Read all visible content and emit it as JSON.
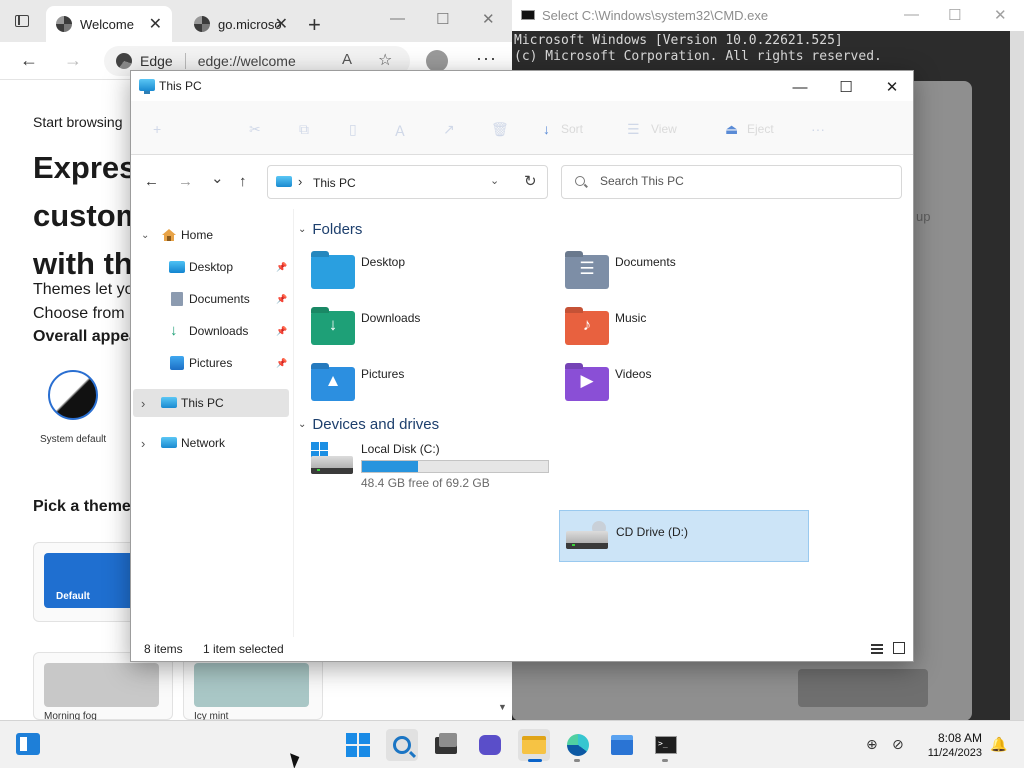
{
  "edge": {
    "tabs": [
      {
        "title": "Welcome",
        "close": "✕"
      },
      {
        "title": "go.microso",
        "close": "✕"
      }
    ],
    "new_tab": "+",
    "window_controls": {
      "minimize": "—",
      "maximize": "☐",
      "close": "✕"
    },
    "address": {
      "site_label": "Edge",
      "url": "edge://welcome"
    },
    "content": {
      "start_browsing": "Start browsing",
      "heading_lines": [
        "Express",
        "custom",
        "with th"
      ],
      "body_lines": [
        "Themes let yo",
        "Choose from"
      ],
      "overall_appearance": "Overall appea",
      "system_default": "System default",
      "pick_theme": "Pick a theme",
      "themes": [
        {
          "name": "Default",
          "color": "#1f6fd0"
        },
        {
          "name": "Morning fog",
          "color": "#c8c8c8"
        },
        {
          "name": "Icy mint",
          "color": "#a9c7c6"
        }
      ]
    }
  },
  "cmd": {
    "title": "Select C:\\Windows\\system32\\CMD.exe",
    "lines": [
      "Microsoft Windows [Version 10.0.22621.525]",
      "(c) Microsoft Corporation. All rights reserved."
    ],
    "overlay_text": "up",
    "window_controls": {
      "minimize": "—",
      "maximize": "☐",
      "close": "✕"
    }
  },
  "explorer": {
    "title": "This PC",
    "window_controls": {
      "minimize": "—",
      "maximize": "☐",
      "close": "✕"
    },
    "ribbon": {
      "icons": [
        "+",
        "✂",
        "⧉",
        "▯",
        "Ａ",
        "↗",
        "🗑",
        "↓",
        "☰",
        "⏏",
        "···"
      ],
      "labels": [
        "Sort",
        "View",
        "Eject"
      ]
    },
    "nav": {
      "back": "←",
      "forward": "→",
      "recent": "⌄",
      "up": "↑",
      "address_sep": "›",
      "address_location": "This PC",
      "address_dropdown": "⌄",
      "refresh": "↻",
      "search_placeholder": "Search This PC"
    },
    "sidebar": {
      "home": "Home",
      "quick_access": [
        {
          "label": "Desktop",
          "pin": "📌"
        },
        {
          "label": "Documents",
          "pin": "📌"
        },
        {
          "label": "Downloads",
          "pin": "📌"
        },
        {
          "label": "Pictures",
          "pin": "📌"
        }
      ],
      "this_pc": "This PC",
      "network": "Network",
      "chevron_open": "⌄",
      "chevron_closed": "›"
    },
    "folders_header": "Folders",
    "folders": [
      {
        "name": "Desktop",
        "glyph": "",
        "color": "#2a9fe0"
      },
      {
        "name": "Documents",
        "glyph": "☰",
        "color": "#7d8ea6"
      },
      {
        "name": "Downloads",
        "glyph": "↓",
        "color": "#1ea077"
      },
      {
        "name": "Music",
        "glyph": "♪",
        "color": "#e8613f"
      },
      {
        "name": "Pictures",
        "glyph": "▲",
        "color": "#2c8fe0"
      },
      {
        "name": "Videos",
        "glyph": "▶",
        "color": "#8a4fd6"
      }
    ],
    "drives_header": "Devices and drives",
    "drives": [
      {
        "name": "Local Disk (C:)",
        "free_text": "48.4 GB free of 69.2 GB",
        "used_fraction": 0.3
      },
      {
        "name": "CD Drive (D:)"
      }
    ],
    "status": {
      "item_count": "8 items",
      "selected": "1 item selected"
    }
  },
  "taskbar": {
    "time": "8:08 AM",
    "date": "11/24/2023",
    "tray_icons": [
      "⊕",
      "⊘",
      "🔔"
    ],
    "cmd_glyph": ">_"
  }
}
